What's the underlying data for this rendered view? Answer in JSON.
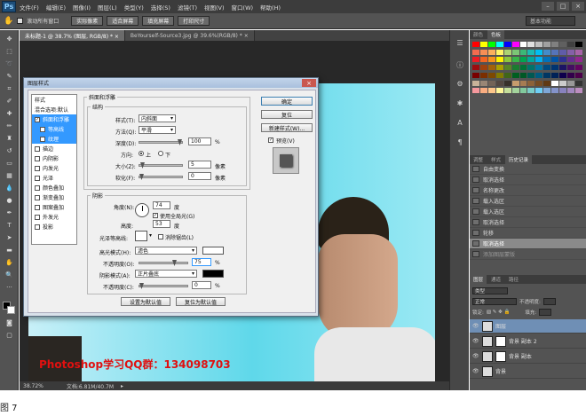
{
  "menubar": {
    "logo": "Ps",
    "items": [
      "文件(F)",
      "编辑(E)",
      "图像(I)",
      "图层(L)",
      "类型(Y)",
      "选择(S)",
      "滤镜(T)",
      "视图(V)",
      "窗口(W)",
      "帮助(H)"
    ],
    "controls": [
      "–",
      "□",
      "×"
    ]
  },
  "options": {
    "scroll_all": "滚动所有窗口",
    "btn_actual": "实际像素",
    "btn_fit": "适合屏幕",
    "btn_fill": "填充屏幕",
    "btn_print": "打印尺寸",
    "workspace": "基本功能"
  },
  "tabs": [
    {
      "label": "未标题-1 @ 38.7% (图层, RGB/8) * ×"
    },
    {
      "label": "BeYourself-Source3.jpg @ 39.6%(RGB/8) * ×"
    }
  ],
  "canvas": {
    "watermark": "Photoshop学习QQ群：134098703"
  },
  "status": {
    "zoom": "38.72%",
    "doc": "文档:6.81M/40.7M"
  },
  "panels": {
    "swatch_tabs": [
      "颜色",
      "色板"
    ],
    "history_tabs": [
      "调整",
      "样式",
      "历史记录"
    ],
    "history": [
      {
        "label": "自由变换",
        "state": "normal"
      },
      {
        "label": "取消选择",
        "state": "normal"
      },
      {
        "label": "名称更改",
        "state": "normal"
      },
      {
        "label": "载入选区",
        "state": "normal"
      },
      {
        "label": "载入选区",
        "state": "normal"
      },
      {
        "label": "取消选择",
        "state": "normal"
      },
      {
        "label": "轮移",
        "state": "normal"
      },
      {
        "label": "取消选择",
        "state": "selected"
      },
      {
        "label": "添加图层蒙版",
        "state": "faded"
      }
    ],
    "layer_tabs": [
      "图层",
      "通道",
      "路径"
    ],
    "kind": "类型",
    "blend": "正常",
    "opacity_label": "不透明度:",
    "lock_label": "锁定:",
    "fill_label": "填充:",
    "layers": [
      {
        "name": "图层",
        "selected": true
      },
      {
        "name": "背景 副本 2",
        "selected": false
      },
      {
        "name": "背景 副本",
        "selected": false
      },
      {
        "name": "背景",
        "selected": false
      }
    ]
  },
  "swatch_colors": [
    "#ff0000",
    "#ffff00",
    "#00ff00",
    "#00ffff",
    "#0000ff",
    "#ff00ff",
    "#ffffff",
    "#e0e0e0",
    "#c0c0c0",
    "#a0a0a0",
    "#808080",
    "#606060",
    "#404040",
    "#000000",
    "#f26c4f",
    "#f68e55",
    "#fbaf5c",
    "#fff467",
    "#acd372",
    "#7cc576",
    "#3bb878",
    "#1abbb4",
    "#00bff3",
    "#438cca",
    "#5574b9",
    "#605ca8",
    "#855fa8",
    "#a763a8",
    "#ed1c24",
    "#f26522",
    "#f7941d",
    "#fff200",
    "#8dc73f",
    "#39b54a",
    "#00a651",
    "#00a99d",
    "#00aeef",
    "#0072bc",
    "#0054a6",
    "#2e3192",
    "#662d91",
    "#92278f",
    "#9e0b0f",
    "#a0410d",
    "#a36209",
    "#aba000",
    "#598527",
    "#1a7b30",
    "#007236",
    "#00746b",
    "#0076a3",
    "#004b80",
    "#003471",
    "#1b1464",
    "#440e62",
    "#630460",
    "#790000",
    "#7b2e00",
    "#7d4900",
    "#827b00",
    "#406618",
    "#005e20",
    "#005826",
    "#005952",
    "#005b7f",
    "#003663",
    "#002157",
    "#0d004c",
    "#32004b",
    "#4b0049",
    "#c7b299",
    "#998675",
    "#736357",
    "#534741",
    "#37302a",
    "#c69c6d",
    "#a67c52",
    "#8c6239",
    "#754c24",
    "#603913",
    "#ffffff",
    "#cccccc",
    "#999999",
    "#333333",
    "#f5989d",
    "#f9ad81",
    "#fdc68a",
    "#fff79a",
    "#c4df9b",
    "#a3d39c",
    "#82ca9d",
    "#7bcdc8",
    "#6ecff6",
    "#7ea7d8",
    "#8493ca",
    "#8882be",
    "#a187be",
    "#bc8dbf"
  ],
  "dialog": {
    "title": "图层样式",
    "close": "×",
    "styles_header": "样式",
    "blend_default": "混合选项:默认",
    "items": [
      {
        "label": "斜面和浮雕",
        "checked": true,
        "highlight": true,
        "sub": false
      },
      {
        "label": "等高线",
        "checked": false,
        "highlight": true,
        "sub": true
      },
      {
        "label": "纹理",
        "checked": false,
        "highlight": true,
        "sub": true
      },
      {
        "label": "描边",
        "checked": false,
        "highlight": false,
        "sub": false
      },
      {
        "label": "内阴影",
        "checked": false,
        "highlight": false,
        "sub": false
      },
      {
        "label": "内发光",
        "checked": false,
        "highlight": false,
        "sub": false
      },
      {
        "label": "光泽",
        "checked": false,
        "highlight": false,
        "sub": false
      },
      {
        "label": "颜色叠加",
        "checked": false,
        "highlight": false,
        "sub": false
      },
      {
        "label": "渐变叠加",
        "checked": false,
        "highlight": false,
        "sub": false
      },
      {
        "label": "图案叠加",
        "checked": false,
        "highlight": false,
        "sub": false
      },
      {
        "label": "外发光",
        "checked": false,
        "highlight": false,
        "sub": false
      },
      {
        "label": "投影",
        "checked": false,
        "highlight": false,
        "sub": false
      }
    ],
    "bevel": {
      "group": "斜面和浮雕",
      "structure": "结构",
      "style_label": "样式(T):",
      "style_value": "内斜面",
      "technique_label": "方法(Q):",
      "technique_value": "平滑",
      "depth_label": "深度(D):",
      "depth_value": "100",
      "depth_unit": "%",
      "depth_level": 1.0,
      "direction_label": "方向:",
      "dir_up": "上",
      "dir_down": "下",
      "size_label": "大小(Z):",
      "size_value": "5",
      "size_unit": "像素",
      "size_level": 0.02,
      "soften_label": "软化(F):",
      "soften_value": "0",
      "soften_unit": "像素",
      "soften_level": 0.0
    },
    "shading": {
      "group": "阴影",
      "angle_label": "角度(N):",
      "angle_value": "74",
      "angle_unit": "度",
      "global_light": "使用全局光(G)",
      "altitude_label": "高度:",
      "altitude_value": "53",
      "altitude_unit": "度",
      "contour_label": "光泽等高线:",
      "antialias": "消除锯齿(L)",
      "highlight_mode_label": "高光模式(H):",
      "highlight_mode": "滤色",
      "highlight_color": "#ffffff",
      "highlight_opacity_label": "不透明度(O):",
      "highlight_opacity": "75",
      "highlight_opacity_level": 0.75,
      "shadow_mode_label": "阴影模式(A):",
      "shadow_mode": "正片叠底",
      "shadow_color": "#000000",
      "shadow_opacity_label": "不透明度(C):",
      "shadow_opacity": "0",
      "shadow_opacity_level": 0.0,
      "pct": "%"
    },
    "btn_set_default": "设置为默认值",
    "btn_reset_default": "复位为默认值",
    "btn_ok": "确定",
    "btn_reset": "复位",
    "btn_new_style": "新建样式(W)...",
    "preview": "预览(V)"
  },
  "caption": "图 7"
}
